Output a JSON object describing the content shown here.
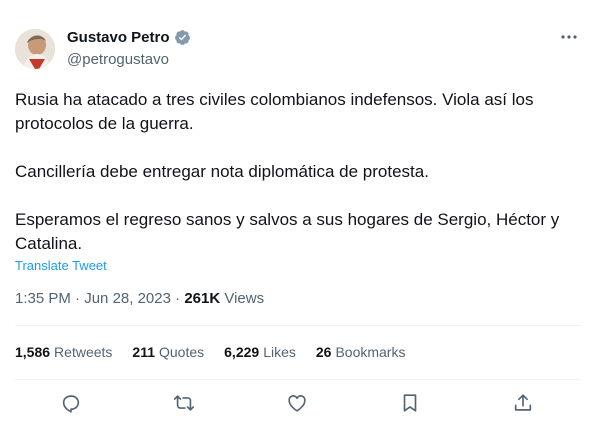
{
  "author": {
    "name": "Gustavo Petro",
    "handle": "@petrogustavo",
    "verified_color": "#829aab"
  },
  "tweet": {
    "text": "Rusia ha atacado a tres civiles colombianos indefensos. Viola así los\nprotocolos de la guerra.\n\nCancillería debe entregar nota diplomática de protesta.\n\nEsperamos el regreso sanos y salvos a sus hogares de Sergio, Héctor y\nCatalina.",
    "translate_label": "Translate Tweet",
    "time": "1:35 PM",
    "date": "Jun 28, 2023",
    "views_count": "261K",
    "views_label": "Views"
  },
  "stats": {
    "retweets_count": "1,586",
    "retweets_label": "Retweets",
    "quotes_count": "211",
    "quotes_label": "Quotes",
    "likes_count": "6,229",
    "likes_label": "Likes",
    "bookmarks_count": "26",
    "bookmarks_label": "Bookmarks"
  },
  "actions": [
    "reply-icon",
    "retweet-icon",
    "like-icon",
    "bookmark-icon",
    "share-icon"
  ],
  "colors": {
    "link": "#1d9bf0",
    "secondary": "#536471",
    "text": "#0f1419"
  }
}
